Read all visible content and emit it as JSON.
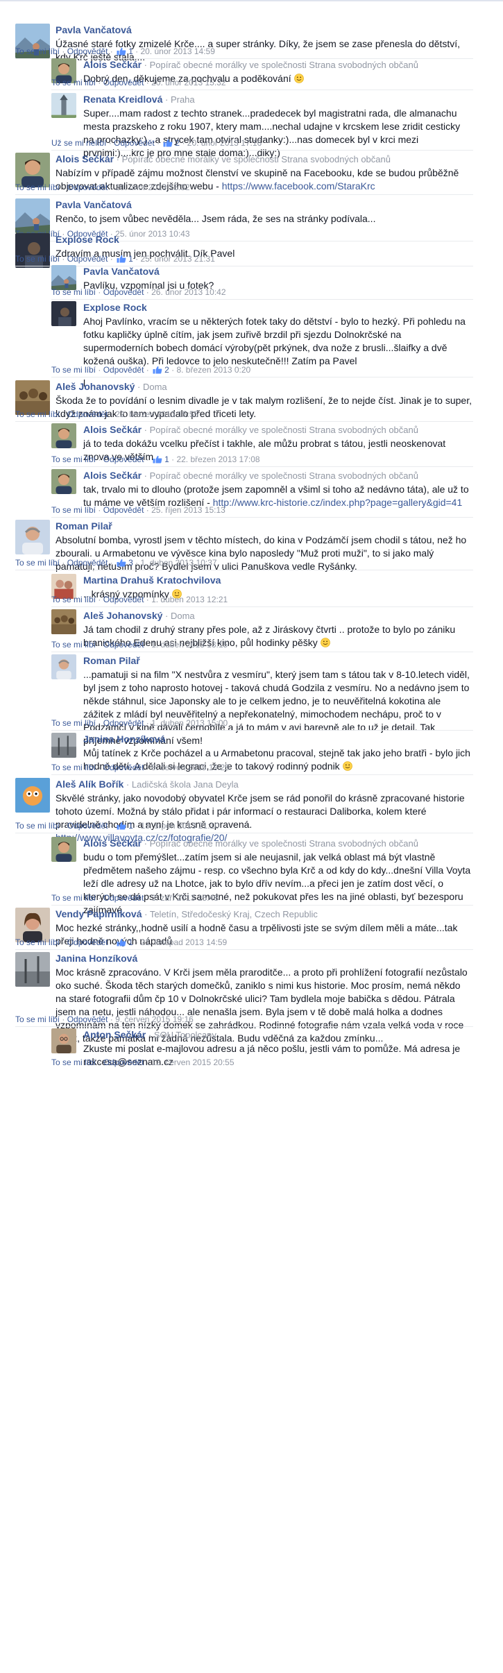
{
  "actions": {
    "like": "To se mi líbí",
    "unlike": "Už se mi nelíbí",
    "reply": "Odpovědět",
    "dot": " · "
  },
  "comments": [
    {
      "name": "Pavla Vančatová",
      "affil": "",
      "text": "Úžasné staré fotky zmizelé Krče.... a super stránky. Díky, že jsem se zase přenesla do dětství, kdy Krč ještě stála....",
      "likes": "1",
      "time": "20. únor 2013 14:59",
      "avatar": "mountain-avatar"
    },
    {
      "name": "Alois Sečkár",
      "affil": "Popírač obecné morálky ve společnosti Strana svobodných občanů",
      "text": "Dobrý den, děkujeme za pochvalu a poděkování",
      "emoji": true,
      "likes": "",
      "time": "20. únor 2013 15:32",
      "avatar": "man-avatar"
    },
    {
      "name": "Renata Kreidlová",
      "affil": "Praha",
      "text": "Super....mam radost z techto stranek...pradedecek byl magistratni rada, dle almanachu mesta prazskeho z roku 1907, ktery mam....nechal udajne v krcskem lese zridit cesticky na prochazky:)...a strycek tam otviral studanky:)...nas domecek byl v krci mezi prvnimi:)....krc je pro mne stale doma:)...diky:)",
      "likes": "2",
      "time": "20. únor 2013 17:16",
      "liked": true,
      "avatar": "tower-avatar"
    },
    {
      "name": "Alois Sečkár",
      "affil": "Popírač obecné morálky ve společnosti Strana svobodných občanů",
      "text": "Nabízím v případě zájmu možnost členství ve skupině na Facebooku, kde se budou průběžně objevovat aktualizace zdejšího webu - ",
      "link": "https://www.facebook.com/StaraKrc",
      "likes": "",
      "time": "20. únor 2013 15:32",
      "avatar": "man-avatar"
    },
    {
      "name": "Pavla Vančatová",
      "affil": "",
      "text": "Renčo, to jsem vůbec nevěděla... Jsem ráda, že ses na stránky podívala...",
      "likes": "",
      "time": "25. únor 2013 10:43",
      "avatar": "mountain-avatar"
    },
    {
      "name": "Explose Rock",
      "affil": "",
      "text": "Zdravím a musím jen pochválit. Dík Pavel",
      "likes": "1",
      "time": "25. únor 2013 21:31",
      "avatar": "dark-avatar"
    },
    {
      "name": "Pavla Vančatová",
      "affil": "",
      "text": "Pavlíku, vzpomínal jsi u fotek?",
      "likes": "",
      "time": "26. únor 2013 10:42",
      "avatar": "mountain-avatar"
    },
    {
      "name": "Explose Rock",
      "affil": "",
      "text": "Ahoj Pavlínko, vracím se u některých fotek taky do dětství - bylo to hezký. Při pohledu na fotku kapličky úplně cítím, jak jsem zuřivě brzdil při sjezdu Dolnokrčské na supermoderních bobech domácí výroby(pět prkýnek, dva nože z brusli...šlaifky a dvě kožená ouška). Při ledovce to jelo neskutečně!!! Zatím pa Pavel",
      "text2": "l",
      "likes": "2",
      "time": "8. březen 2013 0:20",
      "avatar": "dark-avatar"
    },
    {
      "name": "Aleš Johanovský",
      "affil": "Doma",
      "text": "Škoda že to povídání o lesnim divadle je v tak malym rozlišení, že to nejde číst. Jinak je to super, když znám jak to tam vypadalo před třiceti lety.",
      "likes": "",
      "time": "22. březen 2013 15:55",
      "avatar": "crowd-avatar"
    },
    {
      "name": "Alois Sečkár",
      "affil": "Popírač obecné morálky ve společnosti Strana svobodných občanů",
      "text": "já to teda dokážu vcelku přečíst i takhle, ale můžu probrat s tátou, jestli neoskenovat znova ve větším",
      "likes": "1",
      "time": "22. březen 2013 17:08",
      "avatar": "man-avatar"
    },
    {
      "name": "Alois Sečkár",
      "affil": "Popírač obecné morálky ve společnosti Strana svobodných občanů",
      "text": "tak, trvalo mi to dlouho (protože jsem zapomněl a všiml si toho až nedávno táta), ale už to tu máme ve větším rozlišení - ",
      "link": "http://www.krc-historie.cz/index.php?page=gallery&gid=41",
      "likes": "",
      "time": "25. říjen 2013 15:13",
      "avatar": "man-avatar"
    },
    {
      "name": "Roman Pilař",
      "affil": "",
      "text": "Absolutní bomba, vyrostl jsem v těchto místech, do kina v Podzámčí jsem chodil s tátou, než ho zbourali. u Armabetonu ve vývěsce kina bylo naposledy \"Muž proti muži\", to si jako malý pamatuji, netuším proč? Bydlel jsem v ulici Panuškova vedle Ryšánky.",
      "likes": "3",
      "time": "1. duben 2013 10:37",
      "avatar": "older-man-avatar"
    },
    {
      "name": "Martina Drahuš Kratochvilova",
      "affil": "",
      "text": "...krásný vzpomínky",
      "emoji": true,
      "likes": "",
      "time": "1. duben 2013 12:21",
      "avatar": "couple-avatar"
    },
    {
      "name": "Aleš Johanovský",
      "affil": "Doma",
      "text": "Já tam chodil z druhý strany přes pole, až z Jiráskovy čtvrti .. protože to bylo po zániku branického Edenu asi nejbližší kino, půl hodinky pěšky",
      "emoji": true,
      "likes": "",
      "time": "1. duben 2013 13:15",
      "avatar": "crowd-avatar"
    },
    {
      "name": "Roman Pilař",
      "affil": "",
      "text": "...pamatuji si na film \"X nestvůra z vesmíru\", který jsem tam s tátou tak v 8-10.letech viděl, byl jsem z toho naprosto hotovej - taková chudá Godzila z vesmíru. No a nedávno jsem to někde stáhnul, sice Japonsky ale to je celkem jedno, je to neuvěřitelná kokotina ale zážitek z mládí byl neuvěřitelný a nepřekonatelný, mimochodem nechápu, proč to v Podzámčí v kině dávali černobíle a já to mám v avi barevně ale to už je detail. Tak příjemné vzpomínání všem!",
      "likes": "",
      "time": "1. duben 2013 15:00",
      "avatar": "older-man-avatar"
    },
    {
      "name": "Janina Honzíková",
      "affil": "",
      "text": "Můj tatínek z Krče pocházel a u Armabetonu pracoval, stejně tak jako jeho bratři - bylo jich hodně dětí. A dělali si legraci, že je to takový rodinný podnik",
      "emoji": true,
      "likes": "",
      "time": "9. červen 2015 19:25",
      "avatar": "mist-avatar"
    },
    {
      "name": "Aleš Alík Bořík",
      "affil": "Ladičská škola Jana Deyla",
      "text": "Skvělé stránky, jako novodobý obyvatel Krče jsem se rád ponořil do krásně zpracované historie tohoto území. Možná by stálo přidat i pár informací o restauraci Daliborka, kolem které pravidelně chodím a nyní je krásně opravená.",
      "link": "http://www.villavoyta.cz/cz/fotografie/20/",
      "likes": "1",
      "time": "18. srpen 2013 21:10",
      "avatar": "cartoon-avatar"
    },
    {
      "name": "Alois Sečkár",
      "affil": "Popírač obecné morálky ve společnosti Strana svobodných občanů",
      "text": "budu o tom přemýšlet...zatím jsem si ale neujasnil, jak velká oblast má být vlastně předmětem našeho zájmu - resp. co všechno byla Krč a od kdy do kdy...dnešní Villa Voyta leží dle adresy už na Lhotce, jak to bylo dřív nevím...a přeci jen je zatím dost věcí, o kterých se dá psát v Krči samotné, než pokukovat přes les na jiné oblasti, byť bezesporu zajímavé",
      "likes": "",
      "time": "3. září 2013 15:48",
      "avatar": "man-avatar"
    },
    {
      "name": "Vendy Papírníková",
      "affil": "Teletín, Středočeský Kraj, Czech Republic",
      "text": "Moc hezké stránky,,hodně usilí a hodně času a trpělivosti jste se svým dílem měli a máte...tak přeji hodně nových nápadů",
      "likes": "1",
      "time": "21. listopad 2013 14:59",
      "avatar": "woman-avatar"
    },
    {
      "name": "Janina Honzíková",
      "affil": "",
      "text": "Moc krásně zpracováno. V Krči jsem měla praroditče... a proto při prohlížení fotografií nezůstalo oko suché. Škoda těch starých domečků, zaniklo s nimi kus historie. Moc prosím, nemá někdo na staré fotografii dům čp 10 v Dolnokrčské ulici? Tam bydlela moje babička s dědou. Pátrala jsem na netu, jestli náhodou... ale nenašla jsem. Byla jsem v tě době malá holka a dodnes vzpomínám na ten nízký domek se zahrádkou. Rodinné fotografie nám vzala velká voda v roce 2002, takže památka mi žádná nezůstala. Budu vděčná za každou zmínku...",
      "likes": "",
      "time": "9. červen 2015 19:16",
      "avatar": "mist-avatar"
    },
    {
      "name": "Anton Sečkár",
      "affil": "SOU Topolcany",
      "text": "Zkuste mi poslat e-majlovou adresu a já něco pošlu, jestli vám to pomůže. Má adresa je rakcesa@seznam.cz",
      "likes": "",
      "time": "12. červen 2015 20:55",
      "avatar": "glasses-avatar"
    }
  ]
}
